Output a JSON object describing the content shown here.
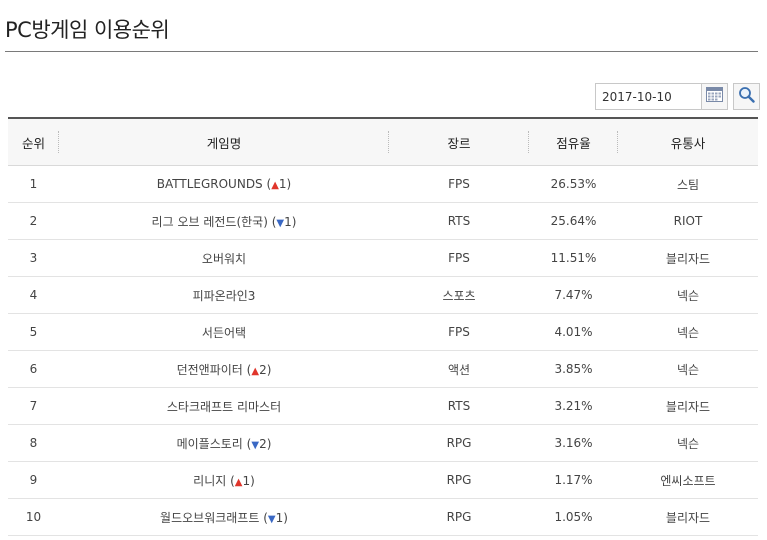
{
  "title": "PC방게임 이용순위",
  "search": {
    "date_value": "2017-10-10"
  },
  "columns": [
    "순위",
    "게임명",
    "장르",
    "점유율",
    "유통사"
  ],
  "rows": [
    {
      "rank": "1",
      "name": "BATTLEGROUNDS",
      "change": "1",
      "dir": "up",
      "genre": "FPS",
      "share": "26.53%",
      "publisher": "스팀"
    },
    {
      "rank": "2",
      "name": "리그 오브 레전드(한국)",
      "change": "1",
      "dir": "down",
      "genre": "RTS",
      "share": "25.64%",
      "publisher": "RIOT"
    },
    {
      "rank": "3",
      "name": "오버워치",
      "change": "",
      "dir": "",
      "genre": "FPS",
      "share": "11.51%",
      "publisher": "블리자드"
    },
    {
      "rank": "4",
      "name": "피파온라인3",
      "change": "",
      "dir": "",
      "genre": "스포츠",
      "share": "7.47%",
      "publisher": "넥슨"
    },
    {
      "rank": "5",
      "name": "서든어택",
      "change": "",
      "dir": "",
      "genre": "FPS",
      "share": "4.01%",
      "publisher": "넥슨"
    },
    {
      "rank": "6",
      "name": "던전앤파이터",
      "change": "2",
      "dir": "up",
      "genre": "액션",
      "share": "3.85%",
      "publisher": "넥슨"
    },
    {
      "rank": "7",
      "name": "스타크래프트 리마스터",
      "change": "",
      "dir": "",
      "genre": "RTS",
      "share": "3.21%",
      "publisher": "블리자드"
    },
    {
      "rank": "8",
      "name": "메이플스토리",
      "change": "2",
      "dir": "down",
      "genre": "RPG",
      "share": "3.16%",
      "publisher": "넥슨"
    },
    {
      "rank": "9",
      "name": "리니지",
      "change": "1",
      "dir": "up",
      "genre": "RPG",
      "share": "1.17%",
      "publisher": "엔씨소프트"
    },
    {
      "rank": "10",
      "name": "월드오브워크래프트",
      "change": "1",
      "dir": "down",
      "genre": "RPG",
      "share": "1.05%",
      "publisher": "블리자드"
    }
  ],
  "icons": {
    "calendar": "calendar-icon",
    "search": "search-icon",
    "up": "arrow-up-icon",
    "down": "arrow-down-icon"
  },
  "colors": {
    "up": "#e0352b",
    "down": "#3a68c4"
  }
}
